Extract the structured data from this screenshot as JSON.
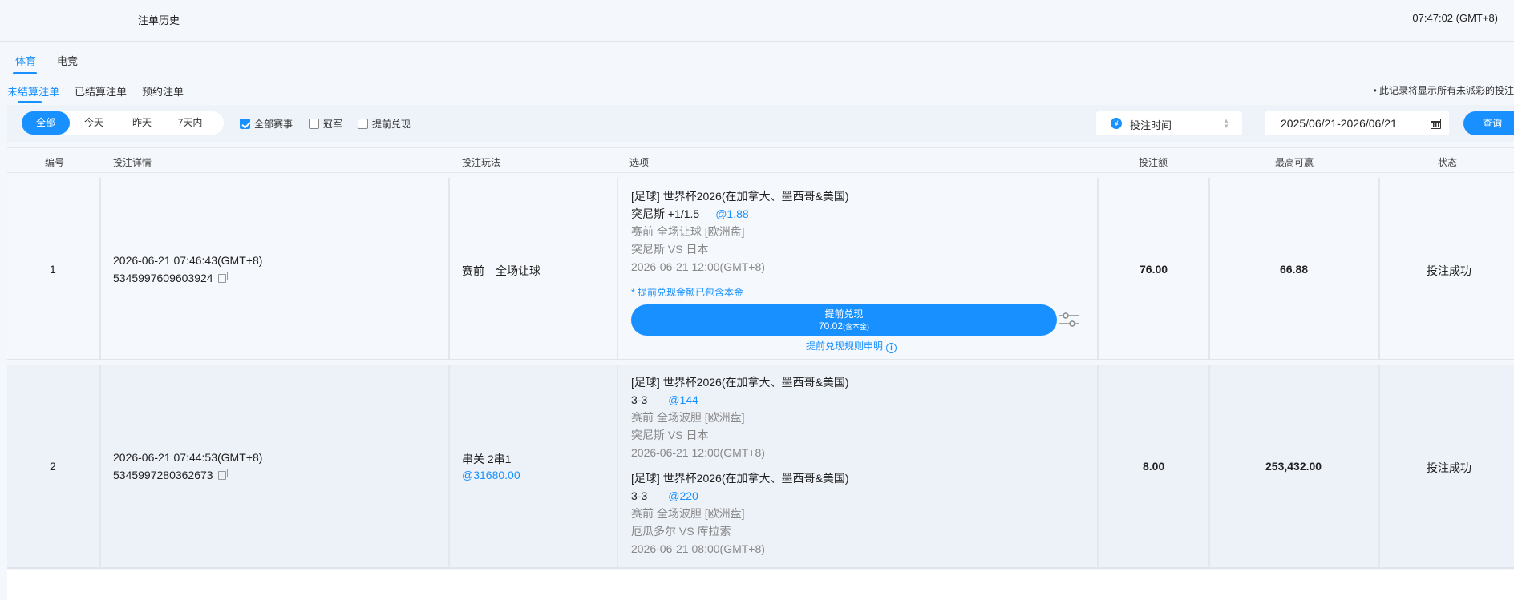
{
  "header": {
    "title": "注单历史",
    "clock": "07:47:02 (GMT+8)"
  },
  "tabs": [
    "体育",
    "电竞"
  ],
  "subtabs": [
    "未结算注单",
    "已结算注单",
    "预约注单"
  ],
  "notice": "• 此记录将显示所有未派彩的投注",
  "filters": {
    "periods": [
      "全部",
      "今天",
      "昨天",
      "7天内"
    ],
    "checkboxes": [
      {
        "label": "全部赛事",
        "checked": true
      },
      {
        "label": "冠军",
        "checked": false
      },
      {
        "label": "提前兑现",
        "checked": false
      }
    ],
    "sort_icon": "¥",
    "sort_label": "投注时间",
    "date_range": "2025/06/21-2026/06/21",
    "query_label": "查询"
  },
  "columns": [
    "编号",
    "投注详情",
    "投注玩法",
    "选项",
    "投注额",
    "最高可赢",
    "状态"
  ],
  "rows": [
    {
      "index": "1",
      "time": "2026-06-21 07:46:43(GMT+8)",
      "bet_id": "5345997609603924",
      "play": "赛前　全场让球",
      "selections": [
        {
          "league": "[足球] 世界杯2026(在加拿大、墨西哥&美国)",
          "pick": "突尼斯 +1/1.5",
          "odds": "@1.88",
          "market": "赛前 全场让球 [欧洲盘]",
          "match": "突尼斯 VS 日本",
          "kickoff": "2026-06-21 12:00(GMT+8)"
        }
      ],
      "cashout": {
        "note": "* 提前兑现金额已包含本金",
        "button_title": "提前兑现",
        "amount": "70.02",
        "amount_suffix": "(含本金)",
        "rules_label": "提前兑现规则申明"
      },
      "stake": "76.00",
      "max_win": "66.88",
      "status": "投注成功"
    },
    {
      "index": "2",
      "time": "2026-06-21 07:44:53(GMT+8)",
      "bet_id": "5345997280362673",
      "play": "串关 2串1",
      "play_odds": "@31680.00",
      "selections": [
        {
          "league": "[足球] 世界杯2026(在加拿大、墨西哥&美国)",
          "pick": "3-3",
          "odds": "@144",
          "market": "赛前 全场波胆 [欧洲盘]",
          "match": "突尼斯 VS 日本",
          "kickoff": "2026-06-21 12:00(GMT+8)"
        },
        {
          "league": "[足球] 世界杯2026(在加拿大、墨西哥&美国)",
          "pick": "3-3",
          "odds": "@220",
          "market": "赛前 全场波胆 [欧洲盘]",
          "match": "厄瓜多尔 VS 库拉索",
          "kickoff": "2026-06-21 08:00(GMT+8)"
        }
      ],
      "stake": "8.00",
      "max_win": "253,432.00",
      "status": "投注成功"
    }
  ]
}
